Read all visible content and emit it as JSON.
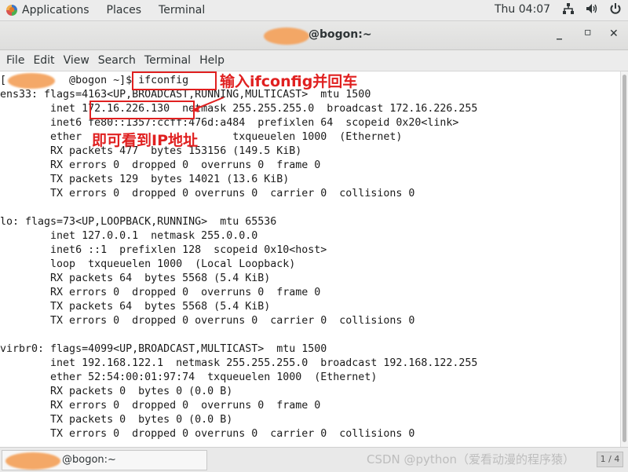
{
  "topbar": {
    "applications": "Applications",
    "places": "Places",
    "terminal": "Terminal",
    "clock": "Thu 04:07",
    "icons": [
      "network-icon",
      "volume-icon",
      "power-icon"
    ]
  },
  "window": {
    "title": "@bogon:~",
    "minimize": "_",
    "maximize": "▫",
    "close": "✕"
  },
  "menubar": [
    "File",
    "Edit",
    "View",
    "Search",
    "Terminal",
    "Help"
  ],
  "terminal": {
    "lines": [
      "[          @bogon ~]$ ifconfig",
      "ens33: flags=4163<UP,BROADCAST,RUNNING,MULTICAST>  mtu 1500",
      "        inet 172.16.226.130  netmask 255.255.255.0  broadcast 172.16.226.255",
      "        inet6 fe80::1357:ccff:476d:a484  prefixlen 64  scopeid 0x20<link>",
      "        ether                        txqueuelen 1000  (Ethernet)",
      "        RX packets 477  bytes 153156 (149.5 KiB)",
      "        RX errors 0  dropped 0  overruns 0  frame 0",
      "        TX packets 129  bytes 14021 (13.6 KiB)",
      "        TX errors 0  dropped 0 overruns 0  carrier 0  collisions 0",
      "",
      "lo: flags=73<UP,LOOPBACK,RUNNING>  mtu 65536",
      "        inet 127.0.0.1  netmask 255.0.0.0",
      "        inet6 ::1  prefixlen 128  scopeid 0x10<host>",
      "        loop  txqueuelen 1000  (Local Loopback)",
      "        RX packets 64  bytes 5568 (5.4 KiB)",
      "        RX errors 0  dropped 0  overruns 0  frame 0",
      "        TX packets 64  bytes 5568 (5.4 KiB)",
      "        TX errors 0  dropped 0 overruns 0  carrier 0  collisions 0",
      "",
      "virbr0: flags=4099<UP,BROADCAST,MULTICAST>  mtu 1500",
      "        inet 192.168.122.1  netmask 255.255.255.0  broadcast 192.168.122.255",
      "        ether 52:54:00:01:97:74  txqueuelen 1000  (Ethernet)",
      "        RX packets 0  bytes 0 (0.0 B)",
      "        RX errors 0  dropped 0  overruns 0  frame 0",
      "        TX packets 0  bytes 0 (0.0 B)",
      "        TX errors 0  dropped 0 overruns 0  carrier 0  collisions 0"
    ]
  },
  "annotations": {
    "command_note": "输入ifconfig并回车",
    "ip_note": "即可看到IP地址"
  },
  "taskbar": {
    "task_label": "@bogon:~",
    "watermark": "CSDN @python（爱看动漫的程序猿）",
    "pager": "1 / 4"
  },
  "colors": {
    "annotation": "#e02020",
    "redaction": "#f4a460"
  }
}
